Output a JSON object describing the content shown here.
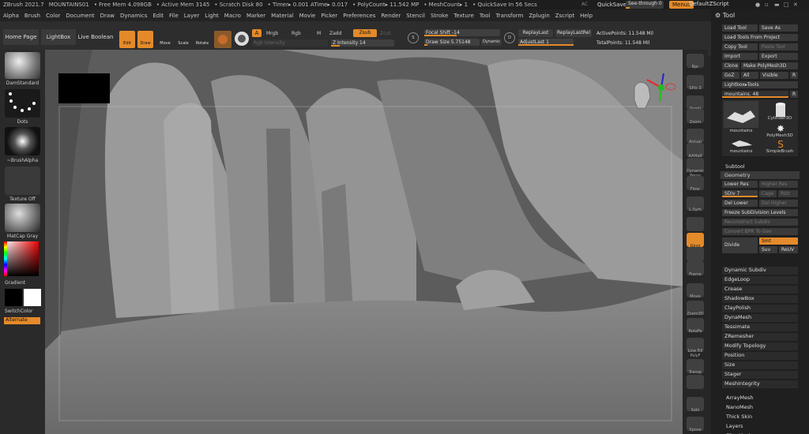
{
  "status": {
    "app": "ZBrush 2021.7",
    "doc": "MOUNTAINS01",
    "free_mem": "• Free Mem 4.098GB",
    "active_mem": "• Active Mem 3145",
    "scratch": "• Scratch Disk 80",
    "timer": "• Timer▸ 0.001 ATime▸ 0.017",
    "polycount": "• PolyCount▸ 11.542 MP",
    "meshcount": "• MeshCount▸ 1",
    "quicksave_in": "• QuickSave In 56 Secs",
    "ac": "AC",
    "quicksave": "QuickSave",
    "seethrough": "See-through",
    "seethrough_val": "0",
    "menus": "Menus",
    "script": "DefaultZScript"
  },
  "menu": [
    "Alpha",
    "Brush",
    "Color",
    "Document",
    "Draw",
    "Dynamics",
    "Edit",
    "File",
    "Layer",
    "Light",
    "Macro",
    "Marker",
    "Material",
    "Movie",
    "Picker",
    "Preferences",
    "Render",
    "Stencil",
    "Stroke",
    "Texture",
    "Tool",
    "Transform",
    "Zplugin",
    "Zscript",
    "Help"
  ],
  "toolbar": {
    "home": "Home Page",
    "lightbox": "LightBox",
    "livebool": "Live Boolean",
    "edit": "Edit",
    "draw": "Draw",
    "move": "Move",
    "scale": "Scale",
    "rotate": "Rotate",
    "a": "A",
    "mrgb": "Mrgb",
    "rgb": "Rgb",
    "m": "M",
    "zadd": "Zadd",
    "zsub": "Zsub",
    "zcut": "Zcut",
    "rgb_int": "Rgb Intensity",
    "z_int": "Z Intensity 14",
    "focal": "Focal Shift -14",
    "drawsize": "Draw Size 5.75148",
    "dynamic": "Dynamic",
    "replaylast": "ReplayLast",
    "replaylastrel": "ReplayLastRel",
    "adjustlast": "AdjustLast 1",
    "activepoints": "ActivePoints: 11.548 Mil",
    "totalpoints": "TotalPoints: 11.548 Mil",
    "s": "S",
    "d": "D"
  },
  "left": {
    "brush": "DamStandard",
    "stroke": "Dots",
    "alpha": "~BrushAlpha",
    "texture": "Texture Off",
    "material": "MatCap Gray",
    "gradient": "Gradient",
    "switchcolor": "SwitchColor",
    "alternate": "Alternate"
  },
  "right": [
    "Bpr",
    "SPix 3",
    "Scroll",
    "Zoom",
    "Actual",
    "AAHalf",
    "Dynamic Persp",
    "Floor",
    "L.Sym",
    "",
    "Gxyz",
    "",
    "Frame",
    "Move",
    "Zoom3D",
    "RotaFe",
    "Line Fill PolyF",
    "Transp",
    "",
    "Solo",
    "Xpose"
  ],
  "tool": {
    "title": "Tool",
    "loadtool": "Load Tool",
    "saveas": "Save As",
    "loadproj": "Load Tools From Project",
    "copytool": "Copy Tool",
    "pastetool": "Paste Tool",
    "import": "Import",
    "export": "Export",
    "clone": "Clone",
    "makepoly": "Make PolyMesh3D",
    "goz": "GoZ",
    "all": "All",
    "visible": "Visible",
    "r": "R",
    "lightbox": "Lightbox▸Tools",
    "current": "mountains. 48",
    "r2": "R",
    "thumbs": [
      "mountains",
      "Cylinder3D",
      "mountains",
      "PolyMesh3D",
      "",
      "SimpleBrush"
    ],
    "subtool": "Subtool",
    "geometry": "Geometry",
    "lowerres": "Lower Res",
    "higherres": "Higher Res",
    "sdiv": "SDiv 7",
    "cage": "Cage",
    "rstr": "Rstr",
    "dellower": "Del Lower",
    "delhigher": "Del Higher",
    "freeze": "Freeze SubDivision Levels",
    "reconstruct": "Reconstruct Subdiv",
    "convert": "Convert BPR To Geo",
    "divide": "Divide",
    "smt": "Smt",
    "suv": "Suv",
    "reuv": "ReUV",
    "items": [
      "Dynamic Subdiv",
      "EdgeLoop",
      "Crease",
      "ShadowBox",
      "ClayPolish",
      "DynaMesh",
      "Tessimate",
      "ZRemesher",
      "Modify Topology",
      "Position",
      "Size",
      "Stager",
      "MeshIntegrity"
    ],
    "items2": [
      "ArrayMesh",
      "NanoMesh",
      "Thick Skin",
      "Layers",
      "FiberMesh"
    ]
  },
  "colors": {
    "accent": "#e48a2a",
    "bg": "#262626",
    "panel": "#1f1f1f",
    "viewport": "#595959"
  },
  "icons": {
    "gizmo": "head-gizmo-icon",
    "tool": "gear-icon"
  }
}
